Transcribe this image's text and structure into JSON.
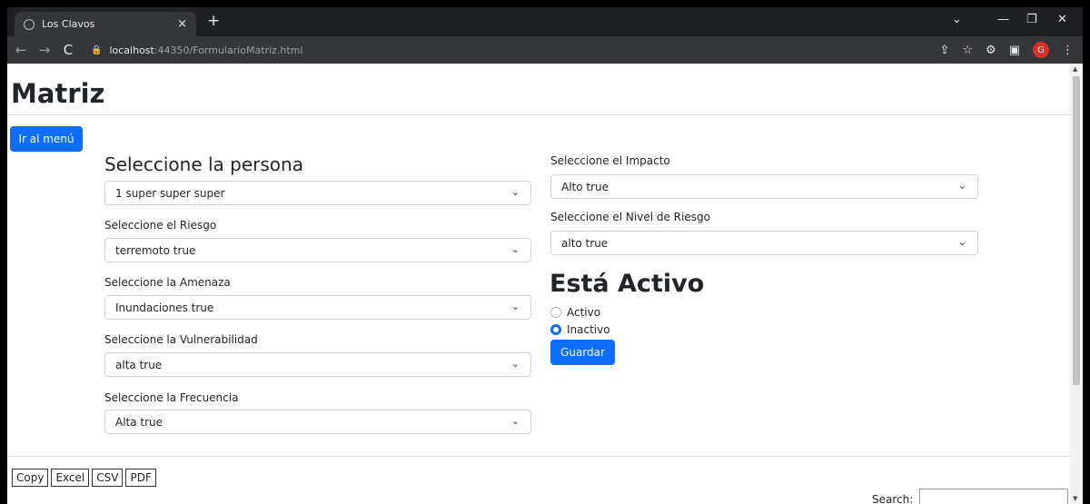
{
  "browser": {
    "tab_title": "Los Clavos",
    "tab_close": "×",
    "new_tab": "+",
    "url_host": "localhost",
    "url_rest": ":44350/FormularioMatriz.html",
    "profile_initial": "G"
  },
  "page": {
    "title": "Matriz",
    "menu_button": "Ir al menú"
  },
  "form": {
    "persona_heading": "Seleccione la persona",
    "persona_value": "1 super super super",
    "riesgo_label": "Seleccione el Riesgo",
    "riesgo_value": "terremoto true",
    "amenaza_label": "Seleccione la Amenaza",
    "amenaza_value": "Inundaciones true",
    "vulnerabilidad_label": "Seleccione la Vulnerabilidad",
    "vulnerabilidad_value": "alta true",
    "frecuencia_label": "Seleccione la Frecuencia",
    "frecuencia_value": "Alta true",
    "impacto_label": "Seleccione el Impacto",
    "impacto_value": "Alto true",
    "nivel_label": "Seleccione el Nivel de Riesgo",
    "nivel_value": "alto true",
    "activo_heading": "Está Activo",
    "radio_activo": "Activo",
    "radio_inactivo": "Inactivo",
    "selected_status": "Inactivo",
    "save_button": "Guardar"
  },
  "table_tools": {
    "buttons": [
      "Copy",
      "Excel",
      "CSV",
      "PDF"
    ],
    "search_label": "Search:"
  },
  "colors": {
    "primary": "#0d6efd",
    "chrome_dark": "#202124",
    "chrome_mid": "#35363a"
  }
}
